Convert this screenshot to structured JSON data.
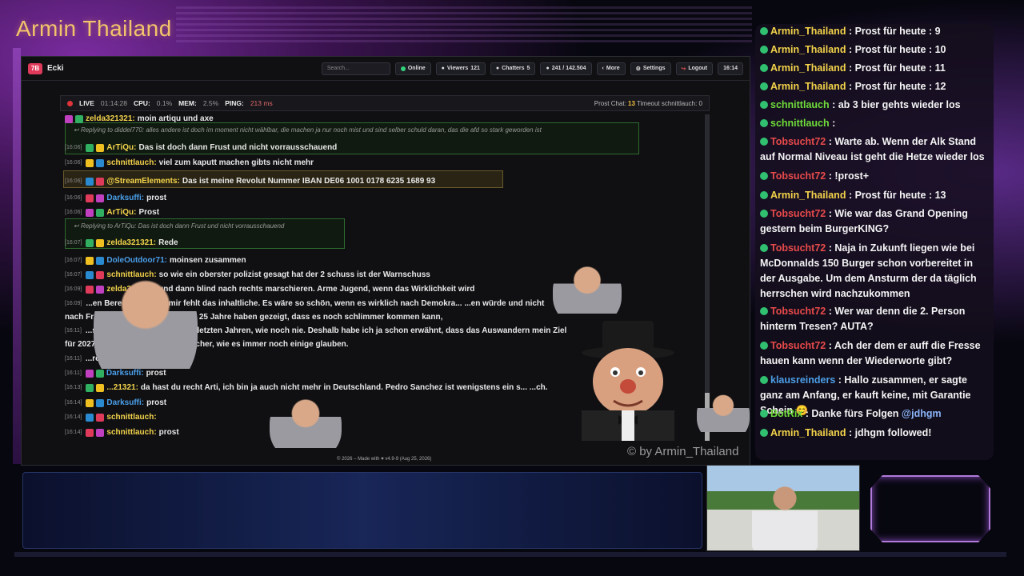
{
  "brand": {
    "title": "Armin Thailand",
    "watermark": "© by Armin_Thailand"
  },
  "app": {
    "logo": "7B",
    "name": "Ecki",
    "search_placeholder": "Search...",
    "buttons": {
      "online": "Online",
      "viewers": "Viewers",
      "viewers_count": "121",
      "chatters": "Chatters",
      "chatters_count": "5",
      "messages": "241 / 142.504",
      "more": "More",
      "settings": "Settings",
      "logout": "Logout",
      "clock": "16:14"
    },
    "status": {
      "live": "LIVE",
      "uptime": "01:14:28",
      "cpu_label": "CPU:",
      "cpu": "0.1%",
      "mem_label": "MEM:",
      "mem": "2.5%",
      "ping_label": "PING:",
      "ping": "213 ms",
      "right_prefix": "Prost Chat:",
      "prost_count": "13",
      "timeout_text": "Timeout schnittlauch: 0"
    },
    "footer": "© 2026 – Made with ♥ v4.9-9 (Aug 25, 2026)"
  },
  "chatlog": {
    "reply1": "Replying to diddel770: alles andere ist doch im moment nicht wählbar, die machen ja nur noch mist und sind selber schuld daran, das die afd so stark geworden ist",
    "reply2": "Replying to ArTiQu: Das ist doch dann Frust und nicht vorrausschauend",
    "messages": [
      {
        "ts": "",
        "nick": "zelda321321:",
        "text": "moin artiqu und axe",
        "color": "#f3d34a"
      },
      {
        "ts": "[16:06]",
        "nick": "ArTiQu:",
        "text": "Das ist doch dann Frust und nicht vorrausschauend",
        "color": "#f3d34a"
      },
      {
        "ts": "[16:06]",
        "nick": "schnittlauch:",
        "text": "viel zum kaputt machen gibts nicht mehr",
        "color": "#f3d34a"
      },
      {
        "ts": "[16:06]",
        "nick": "@StreamElements:",
        "text": "Das ist meine Revolut Nummer IBAN DE06 1001 0178 6235 1689 93",
        "color": "#f3d34a"
      },
      {
        "ts": "[16:06]",
        "nick": "Darksuffi:",
        "text": "prost",
        "color": "#4a9fe8"
      },
      {
        "ts": "[16:06]",
        "nick": "ArTiQu:",
        "text": "Prost",
        "color": "#f3d34a"
      },
      {
        "ts": "[16:07]",
        "nick": "zelda321321:",
        "text": "Rede",
        "color": "#f3d34a"
      },
      {
        "ts": "[16:07]",
        "nick": "DoleOutdoor71:",
        "text": "moinsen zusammen",
        "color": "#4a9fe8"
      },
      {
        "ts": "[16:07]",
        "nick": "schnittlauch:",
        "text": "so wie ein oberster polizist gesagt hat der 2 schuss ist der Warnschuss",
        "color": "#f3d34a"
      },
      {
        "ts": "[16:09]",
        "nick": "zelda321321:",
        "text": "und dann blind nach rechts marschieren. Arme Jugend, wenn das Wirklichkeit wird",
        "color": "#f3d34a"
      },
      {
        "ts": "[16:09]",
        "nick": "",
        "text": "...en Bereichen, doch mir fehlt das inhaltliche. Es wäre so schön, wenn es wirklich nach Demokra... ...en würde und nicht",
        "color": "#f3d34a"
      },
      {
        "ts": "",
        "nick": "",
        "text": "nach Fr... ...schen, doch die letzten 25 Jahre haben gezeigt, dass es noch schlimmer kommen kann,",
        "color": "#f3d34a"
      },
      {
        "ts": "[16:11]",
        "nick": "",
        "text": "...skeptisch geworden in den letzten Jahren, wie noch nie. Deshalb habe ich ja schon erwähnt, dass das Auswandern mein Ziel",
        "color": "#f3d34a"
      },
      {
        "ts": "",
        "nick": "",
        "text": "für 2027/... ...eben nicht mehr so sicher, wie es immer noch einige glauben.",
        "color": "#f3d34a"
      },
      {
        "ts": "[16:11]",
        "nick": "",
        "text": "...rost",
        "color": "#f3d34a"
      },
      {
        "ts": "[16:11]",
        "nick": "Darksuffi:",
        "text": "prost",
        "color": "#4a9fe8"
      },
      {
        "ts": "[16:13]",
        "nick": "...21321:",
        "text": "da hast du recht Arti, ich bin ja auch nicht mehr in Deutschland. Pedro Sanchez ist wenigstens ein s... ...ch.",
        "color": "#f3d34a"
      },
      {
        "ts": "[16:14]",
        "nick": "Darksuffi:",
        "text": "prost",
        "color": "#4a9fe8"
      },
      {
        "ts": "[16:14]",
        "nick": "schnittlauch:",
        "text": "",
        "color": "#f3d34a"
      },
      {
        "ts": "[16:14]",
        "nick": "schnittlauch:",
        "text": "prost",
        "color": "#f3d34a"
      }
    ]
  },
  "side_chat": [
    {
      "nick": "Armin_Thailand",
      "text": " : Prost für heute : 9",
      "color": "#f3d34a"
    },
    {
      "nick": "Armin_Thailand",
      "text": " : Prost für heute : 10",
      "color": "#f3d34a"
    },
    {
      "nick": "Armin_Thailand",
      "text": " : Prost für heute : 11",
      "color": "#f3d34a"
    },
    {
      "nick": "Armin_Thailand",
      "text": " : Prost für heute : 12",
      "color": "#f3d34a"
    },
    {
      "nick": "schnittlauch",
      "text": " : ab 3 bier gehts wieder los",
      "color": "#6fdc3a"
    },
    {
      "nick": "schnittlauch",
      "text": " :",
      "color": "#6fdc3a"
    },
    {
      "nick": "Tobsucht72",
      "text": " : Warte ab. Wenn der Alk Stand auf Normal Niveau ist geht die Hetze wieder los",
      "color": "#e84a4a"
    },
    {
      "nick": "Tobsucht72",
      "text": " : !prost+",
      "color": "#e84a4a"
    },
    {
      "nick": "Armin_Thailand",
      "text": " : Prost für heute : 13",
      "color": "#f3d34a"
    },
    {
      "nick": "Tobsucht72",
      "text": " : Wie war das Grand Opening gestern beim BurgerKING?",
      "color": "#e84a4a"
    },
    {
      "nick": "Tobsucht72",
      "text": " : Naja in Zukunft liegen wie bei McDonnalds 150 Burger schon vorbereitet in der Ausgabe. Um dem Ansturm der da täglich herrschen wird nachzukommen",
      "color": "#e84a4a"
    },
    {
      "nick": "Tobsucht72",
      "text": " : Wer war denn die 2. Person hinterm Tresen? AUTA?",
      "color": "#e84a4a"
    },
    {
      "nick": "Tobsucht72",
      "text": " : Ach der dem er auff die Fresse hauen kann wenn der Wiederworte gibt?",
      "color": "#e84a4a"
    },
    {
      "nick": "klausreinders",
      "text": " : Hallo zusammen, er sagte ganz am Anfang, er kauft keine, mit Garantie Schein 😊",
      "color": "#4a9fe8"
    },
    {
      "nick": "BotRix",
      "text": " : Danke fürs Folgen ",
      "color": "#6fdc3a",
      "mention": "@jdhgm"
    },
    {
      "nick": "Armin_Thailand",
      "text": " : jdhgm followed!",
      "color": "#f3d34a"
    }
  ]
}
